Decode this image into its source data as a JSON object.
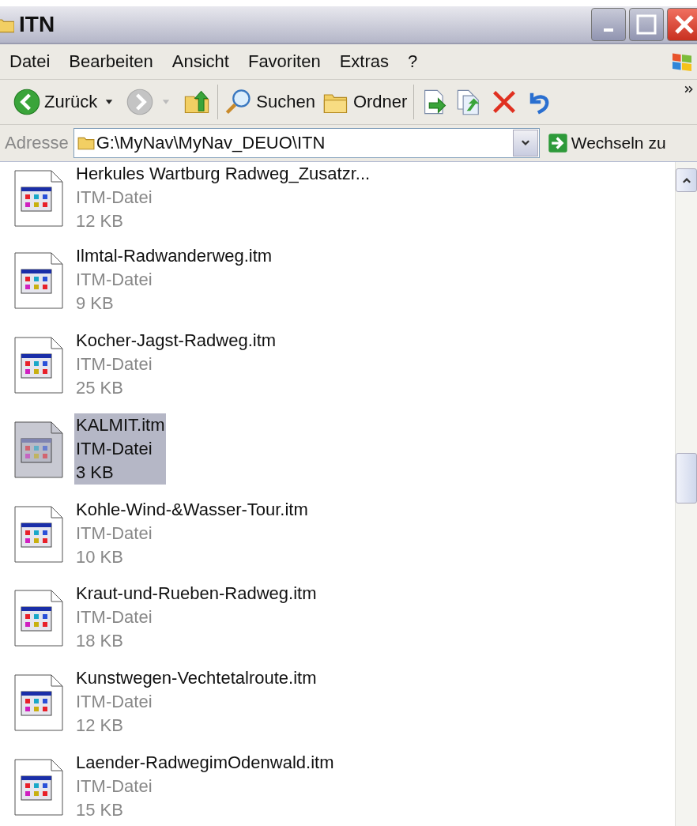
{
  "window": {
    "title": "ITN"
  },
  "menu": [
    "Datei",
    "Bearbeiten",
    "Ansicht",
    "Favoriten",
    "Extras",
    "?"
  ],
  "toolbar": [
    {
      "kind": "back",
      "label": "Zurück",
      "disabled": false
    },
    {
      "kind": "forward",
      "disabled": true
    },
    {
      "kind": "up"
    },
    {
      "kind": "search",
      "label": "Suchen"
    },
    {
      "kind": "folders",
      "label": "Ordner"
    },
    {
      "kind": "move"
    },
    {
      "kind": "copy"
    },
    {
      "kind": "delete"
    },
    {
      "kind": "undo"
    }
  ],
  "address": {
    "label": "Adresse",
    "value": "G:\\MyNav\\MyNav_DEUO\\ITN",
    "go": "Wechseln zu"
  },
  "files": [
    {
      "name": "Herkules Wartburg Radweg_Zusatzr...",
      "type": "ITM-Datei",
      "size": "12 KB",
      "selected": false
    },
    {
      "name": "Ilmtal-Radwanderweg.itm",
      "type": "ITM-Datei",
      "size": "9 KB",
      "selected": false
    },
    {
      "name": "Kocher-Jagst-Radweg.itm",
      "type": "ITM-Datei",
      "size": "25 KB",
      "selected": false
    },
    {
      "name": "KALMIT.itm",
      "type": "ITM-Datei",
      "size": "3 KB",
      "selected": true
    },
    {
      "name": "Kohle-Wind-&Wasser-Tour.itm",
      "type": "ITM-Datei",
      "size": "10 KB",
      "selected": false
    },
    {
      "name": "Kraut-und-Rueben-Radweg.itm",
      "type": "ITM-Datei",
      "size": "18 KB",
      "selected": false
    },
    {
      "name": "Kunstwegen-Vechtetalroute.itm",
      "type": "ITM-Datei",
      "size": "12 KB",
      "selected": false
    },
    {
      "name": "Laender-RadwegimOdenwald.itm",
      "type": "ITM-Datei",
      "size": "15 KB",
      "selected": false
    }
  ]
}
